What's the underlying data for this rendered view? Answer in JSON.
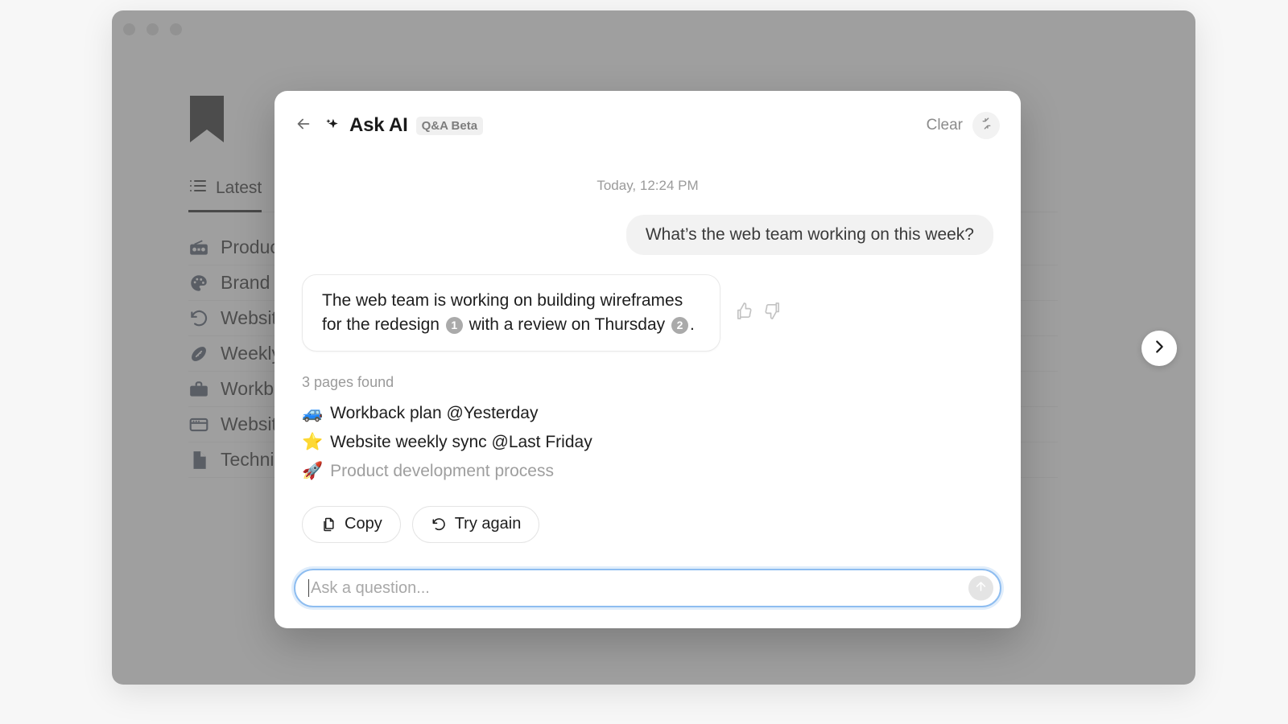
{
  "window": {
    "traffic_lights": [
      "close",
      "minimize",
      "maximize"
    ],
    "logo": "bookmark-logo"
  },
  "background_app": {
    "tab": {
      "label": "Latest",
      "icon": "list-icon"
    },
    "rows": [
      {
        "icon": "radio-icon",
        "label": "Product development process"
      },
      {
        "icon": "palette-icon",
        "label": "Brand guidelines"
      },
      {
        "icon": "refresh-icon",
        "label": "Website redesign"
      },
      {
        "icon": "football-icon",
        "label": "Weekly team sync"
      },
      {
        "icon": "briefcase-icon",
        "label": "Workback plan"
      },
      {
        "icon": "window-icon",
        "label": "Website weekly sync"
      },
      {
        "icon": "document-icon",
        "label": "Technical specs"
      }
    ]
  },
  "next_button": {
    "icon": "chevron-right-icon"
  },
  "modal": {
    "header": {
      "back_icon": "arrow-left-icon",
      "sparkle_icon": "sparkle-icon",
      "title": "Ask AI",
      "badge": "Q&A Beta",
      "clear_label": "Clear",
      "collapse_icon": "collapse-icon"
    },
    "timestamp": "Today, 12:24 PM",
    "user_message": "What’s the web team working on this week?",
    "answer": {
      "part1": "The web team is working on building wireframes for the redesign ",
      "citation1": "1",
      "part2": " with a review on Thursday ",
      "citation2": "2",
      "part3": ".",
      "thumbs_up_icon": "thumbs-up-icon",
      "thumbs_down_icon": "thumbs-down-icon"
    },
    "results_header": "3 pages found",
    "results": [
      {
        "emoji": "🚙",
        "label": "Workback plan @Yesterday",
        "muted": false
      },
      {
        "emoji": "⭐",
        "label": "Website weekly sync @Last Friday",
        "muted": false
      },
      {
        "emoji": "🚀",
        "label": "Product development process",
        "muted": true
      }
    ],
    "actions": [
      {
        "icon": "copy-icon",
        "label": "Copy"
      },
      {
        "icon": "refresh-icon",
        "label": "Try again"
      }
    ],
    "composer": {
      "placeholder": "Ask a question...",
      "value": "",
      "send_icon": "arrow-up-icon"
    }
  },
  "colors": {
    "accent_focus": "#8ebdf0",
    "bubble_bg": "#f2f2f2",
    "citation_bg": "#aaaaaa",
    "muted_text": "#9a9a9a"
  }
}
